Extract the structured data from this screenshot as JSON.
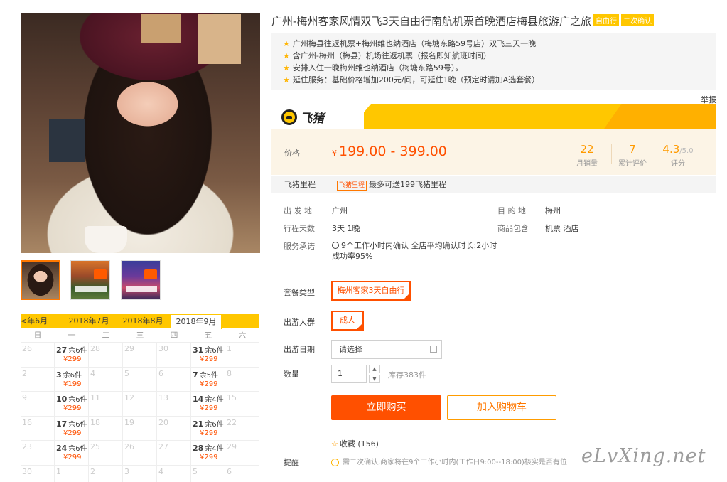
{
  "product": {
    "title": "广州-梅州客家风情双飞3天自由行南航机票首晚酒店梅县旅游广之旅",
    "tags": [
      "自由行",
      "二次确认"
    ],
    "features": [
      "广州梅县往返机票+梅州维也纳酒店（梅塘东路59号店）双飞三天一晚",
      "含广州-梅州（梅县）机场往返机票（报名即知航班时间）",
      "安排入住一晚梅州维也纳酒店（梅塘东路59号）。",
      "延住服务：基础价格增加200元/间，可延住1晚（预定时请加A选套餐）"
    ],
    "report_link": "举报"
  },
  "brand": {
    "name": "飞猪"
  },
  "price": {
    "label": "价格",
    "currency": "¥",
    "range": "199.00 - 399.00",
    "stats": [
      {
        "value": "22",
        "label": "月销量"
      },
      {
        "value": "7",
        "label": "累计评价"
      },
      {
        "value": "4.3",
        "suffix": "/5.0",
        "label": "评分"
      }
    ]
  },
  "mileage": {
    "label": "飞猪里程",
    "tag": "飞猪里程",
    "text": "最多可送199飞猪里程"
  },
  "details": {
    "departure_label": "出 发 地",
    "departure": "广州",
    "destination_label": "目 的 地",
    "destination": "梅州",
    "days_label": "行程天数",
    "days": "3天  1晚",
    "includes_label": "商品包含",
    "includes": "机票  酒店",
    "promise_label": "服务承诺",
    "promise_line1": "9个工作小时内确认 全店平均确认时长:2小时",
    "promise_line2": "成功率95%"
  },
  "options": {
    "package_label": "套餐类型",
    "package_value": "梅州客家3天自由行",
    "group_label": "出游人群",
    "group_value": "成人",
    "date_label": "出游日期",
    "date_placeholder": "请选择",
    "qty_label": "数量",
    "qty_value": "1",
    "stock": "库存383件"
  },
  "actions": {
    "buy": "立即购买",
    "cart": "加入购物车"
  },
  "favorite": {
    "label": "收藏",
    "count": "(156)"
  },
  "reminder": {
    "label": "提醒",
    "text": "需二次确认,商家将在9个工作小时内(工作日9:00--18:00)核实是否有位"
  },
  "calendar": {
    "tabs": [
      "年6月",
      "2018年7月",
      "2018年8月",
      "2018年9月"
    ],
    "active_tab": "2018年9月",
    "weekdays": [
      "日",
      "一",
      "二",
      "三",
      "四",
      "五",
      "六"
    ],
    "rows": [
      [
        {
          "d": "26"
        },
        {
          "d": "27",
          "r": "余6件",
          "p": "¥299"
        },
        {
          "d": "28"
        },
        {
          "d": "29"
        },
        {
          "d": "30"
        },
        {
          "d": "31",
          "r": "余6件",
          "p": "¥299"
        },
        {
          "d": "1"
        }
      ],
      [
        {
          "d": "2"
        },
        {
          "d": "3",
          "r": "余6件",
          "p": "¥199"
        },
        {
          "d": "4"
        },
        {
          "d": "5"
        },
        {
          "d": "6"
        },
        {
          "d": "7",
          "r": "余5件",
          "p": "¥299"
        },
        {
          "d": "8"
        }
      ],
      [
        {
          "d": "9"
        },
        {
          "d": "10",
          "r": "余6件",
          "p": "¥299"
        },
        {
          "d": "11"
        },
        {
          "d": "12"
        },
        {
          "d": "13"
        },
        {
          "d": "14",
          "r": "余4件",
          "p": "¥299"
        },
        {
          "d": "15"
        }
      ],
      [
        {
          "d": "16"
        },
        {
          "d": "17",
          "r": "余6件",
          "p": "¥299"
        },
        {
          "d": "18"
        },
        {
          "d": "19"
        },
        {
          "d": "20"
        },
        {
          "d": "21",
          "r": "余6件",
          "p": "¥299"
        },
        {
          "d": "22"
        }
      ],
      [
        {
          "d": "23"
        },
        {
          "d": "24",
          "r": "余6件",
          "p": "¥299"
        },
        {
          "d": "25"
        },
        {
          "d": "26"
        },
        {
          "d": "27"
        },
        {
          "d": "28",
          "r": "余4件",
          "p": "¥299"
        },
        {
          "d": "29"
        }
      ],
      [
        {
          "d": "30"
        },
        {
          "d": "1"
        },
        {
          "d": "2"
        },
        {
          "d": "3"
        },
        {
          "d": "4"
        },
        {
          "d": "5"
        },
        {
          "d": "6"
        }
      ]
    ]
  },
  "watermark": "eLvXing.net",
  "colors": {
    "accent": "#ff5000",
    "brand_yellow": "#ffc700",
    "price_bg": "#fcf4e6"
  }
}
